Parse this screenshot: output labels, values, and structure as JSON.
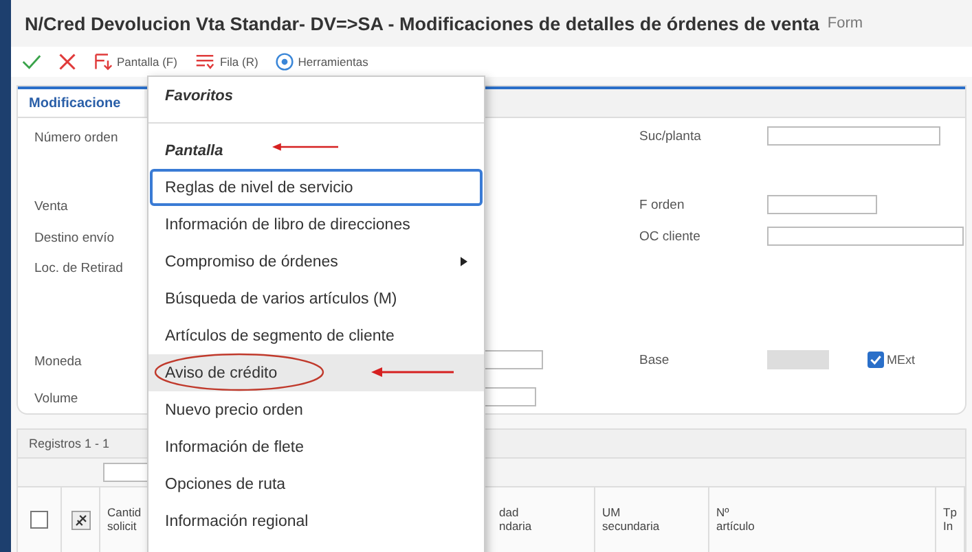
{
  "window": {
    "title": "N/Cred Devolucion Vta Standar- DV=>SA - Modificaciones de detalles de órdenes de venta",
    "title_suffix": "Form"
  },
  "toolbar": [
    {
      "kind": "ok"
    },
    {
      "kind": "cancel"
    },
    {
      "kind": "form",
      "label": "Pantalla (F)"
    },
    {
      "kind": "row",
      "label": "Fila (R)"
    },
    {
      "kind": "tools",
      "label": "Herramientas"
    }
  ],
  "tab": {
    "label": "Modificacione",
    "selected": true
  },
  "form_rows": [
    {
      "left": {
        "label": "Número orden",
        "has_field": false
      },
      "right": {
        "label": "Suc/planta",
        "disabled": false
      }
    },
    {
      "left": {
        "label": "Venta",
        "has_field": false
      },
      "right": {
        "label": "F orden",
        "disabled": false
      }
    },
    {
      "left": {
        "label": "Destino envío",
        "has_field": false
      },
      "right": {
        "label": "OC cliente",
        "disabled": false
      }
    },
    {
      "left": {
        "label": "Loc. de Retirad",
        "has_field": false
      },
      "right": null
    },
    {
      "left": {
        "label": "Moneda",
        "has_field": true
      },
      "right": {
        "label": "Base",
        "disabled": true,
        "checkbox": {
          "label": "MExt",
          "checked": true
        }
      }
    },
    {
      "left": {
        "label": "Volume",
        "has_field": true
      },
      "right": null
    }
  ],
  "grid": {
    "records": "Registros 1 - 1",
    "select_all": {
      "checked": false
    },
    "columns": [
      {
        "label": "Cantid\nsolicit"
      },
      {
        "label": "dad\nndaria"
      },
      {
        "label": "UM\nsecundaria"
      },
      {
        "label": "Nº\nartículo"
      },
      {
        "label": "Tp\nIn"
      }
    ]
  },
  "menu": [
    {
      "kind": "header",
      "label": "Favoritos",
      "focused": false,
      "highlighted": false,
      "submenu": false,
      "arrow": false,
      "circled": false
    },
    {
      "kind": "header",
      "label": "Pantalla",
      "focused": false,
      "highlighted": false,
      "submenu": false,
      "arrow": true,
      "circled": false
    },
    {
      "kind": "item",
      "label": "Reglas de nivel de servicio",
      "focused": true,
      "highlighted": false,
      "submenu": false,
      "arrow": false,
      "circled": false
    },
    {
      "kind": "item",
      "label": "Información de libro de direcciones",
      "focused": false,
      "highlighted": false,
      "submenu": false,
      "arrow": false,
      "circled": false
    },
    {
      "kind": "item",
      "label": "Compromiso de órdenes",
      "focused": false,
      "highlighted": false,
      "submenu": true,
      "arrow": false,
      "circled": false
    },
    {
      "kind": "item",
      "label": "Búsqueda de varios artículos (M)",
      "focused": false,
      "highlighted": false,
      "submenu": false,
      "arrow": false,
      "circled": false
    },
    {
      "kind": "item",
      "label": "Artículos de segmento de cliente",
      "focused": false,
      "highlighted": false,
      "submenu": false,
      "arrow": false,
      "circled": false
    },
    {
      "kind": "item",
      "label": "Aviso de crédito",
      "focused": false,
      "highlighted": true,
      "submenu": false,
      "arrow": true,
      "circled": true
    },
    {
      "kind": "item",
      "label": "Nuevo precio orden",
      "focused": false,
      "highlighted": false,
      "submenu": false,
      "arrow": false,
      "circled": false
    },
    {
      "kind": "item",
      "label": "Información de flete",
      "focused": false,
      "highlighted": false,
      "submenu": false,
      "arrow": false,
      "circled": false
    },
    {
      "kind": "item",
      "label": "Opciones de ruta",
      "focused": false,
      "highlighted": false,
      "submenu": false,
      "arrow": false,
      "circled": false
    },
    {
      "kind": "item",
      "label": "Información regional",
      "focused": false,
      "highlighted": false,
      "submenu": false,
      "arrow": false,
      "circled": false
    }
  ]
}
